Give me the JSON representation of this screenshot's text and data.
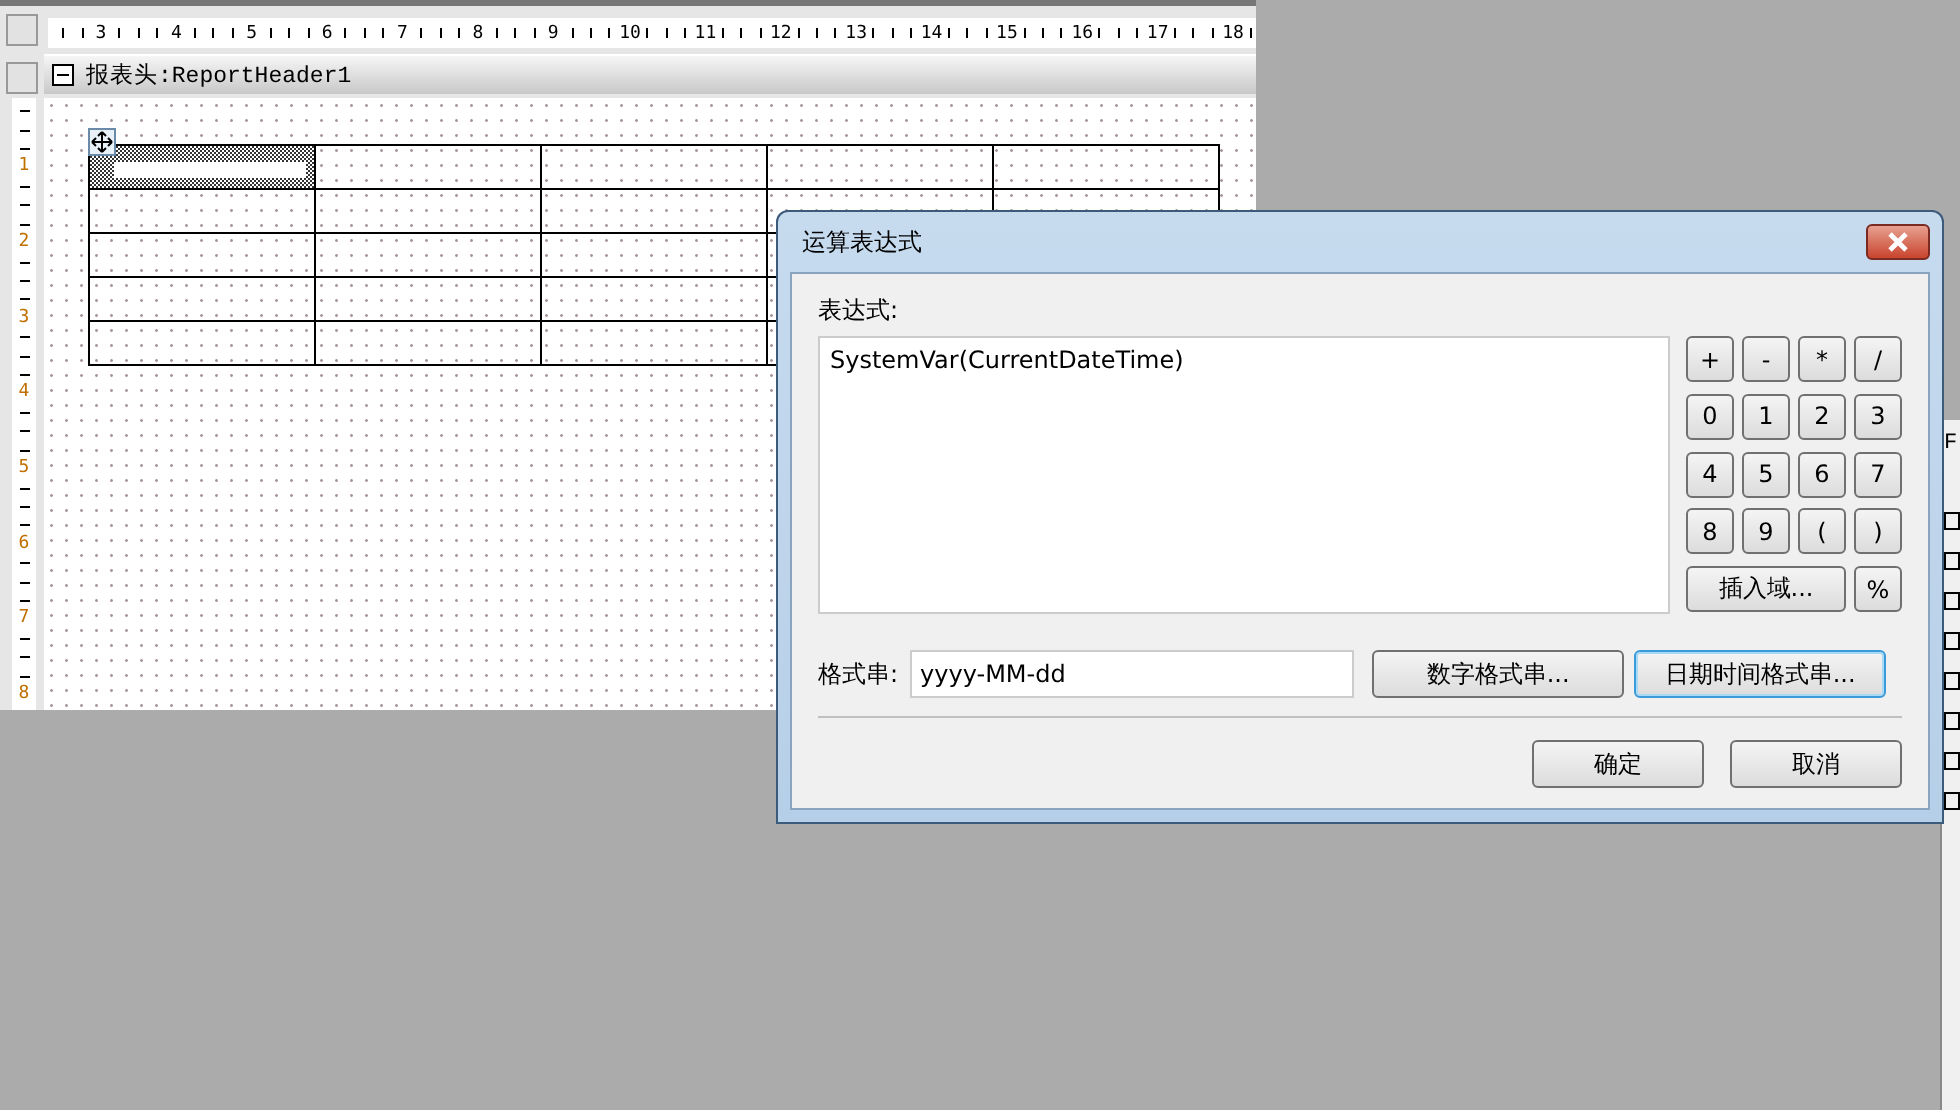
{
  "ruler": {
    "horizontal_labels": [
      "3",
      "4",
      "5",
      "6",
      "7",
      "8",
      "9",
      "10",
      "11",
      "12",
      "13",
      "14",
      "15",
      "16",
      "17",
      "18"
    ],
    "vertical_labels": [
      "1",
      "2",
      "3",
      "4",
      "5",
      "6",
      "7",
      "8"
    ]
  },
  "band": {
    "title": "报表头:ReportHeader1",
    "expanded": true
  },
  "table": {
    "rows": [
      [
        {
          "selected": true
        },
        {
          "selected": false
        },
        {
          "selected": false
        },
        {
          "selected": false
        },
        {
          "selected": false
        }
      ],
      [
        {
          "selected": false
        },
        {
          "selected": false
        },
        {
          "selected": false
        },
        {
          "selected": false
        },
        {
          "selected": false
        }
      ],
      [
        {
          "selected": false
        },
        {
          "selected": false
        },
        {
          "selected": false
        },
        {
          "selected": false
        }
      ],
      [
        {
          "selected": false
        },
        {
          "selected": false
        },
        {
          "selected": false
        },
        {
          "selected": false
        }
      ],
      [
        {
          "selected": false
        },
        {
          "selected": false
        },
        {
          "selected": false
        },
        {
          "selected": false
        }
      ]
    ]
  },
  "dialog": {
    "title": "运算表达式",
    "expression_label": "表达式:",
    "expression": "SystemVar(CurrentDateTime)",
    "keypad": [
      "+",
      "-",
      "*",
      "/",
      "0",
      "1",
      "2",
      "3",
      "4",
      "5",
      "6",
      "7",
      "8",
      "9",
      "(",
      ")"
    ],
    "insert_field_button": "插入域...",
    "percent_button": "%",
    "format_label": "格式串:",
    "format_value": "yyyy-MM-dd",
    "format_buttons": [
      {
        "label": "数字格式串...",
        "focused": false
      },
      {
        "label": "日期时间格式串...",
        "focused": true
      }
    ],
    "buttons": [
      "确定",
      "取消"
    ]
  },
  "side_panel": {
    "header": "F"
  }
}
